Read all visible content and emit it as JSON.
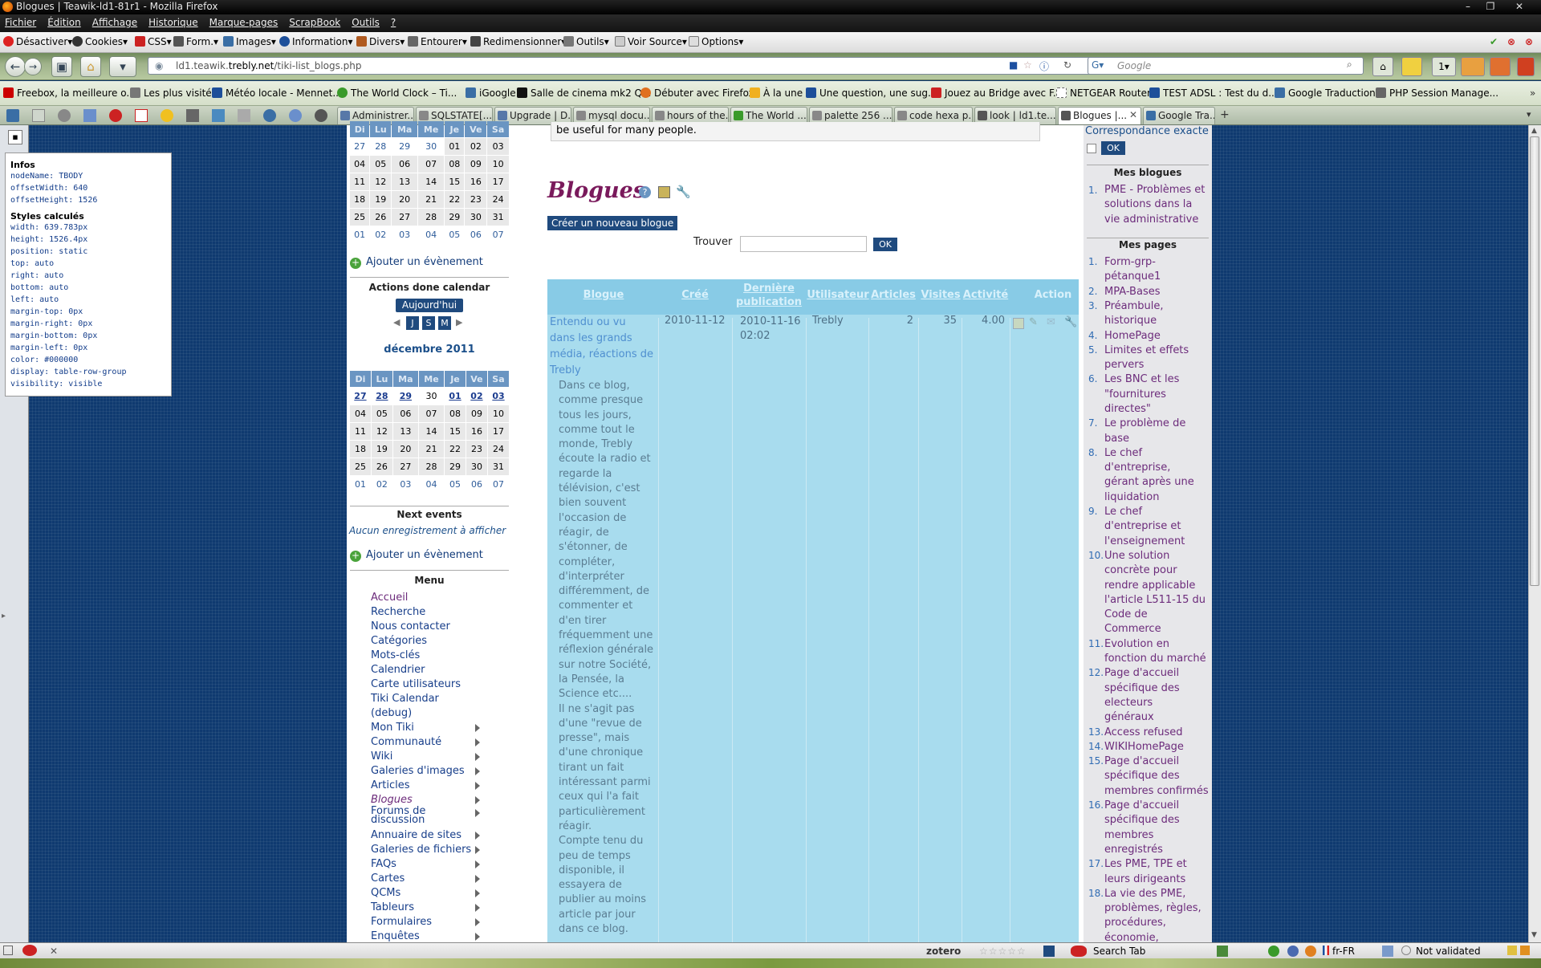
{
  "window": {
    "title": "Blogues | Teawik-ld1-81r1 - Mozilla Firefox"
  },
  "menubar": [
    "Fichier",
    "Édition",
    "Affichage",
    "Historique",
    "Marque-pages",
    "ScrapBook",
    "Outils",
    "?"
  ],
  "webdev": [
    "Désactiver",
    "Cookies",
    "CSS",
    "Form.",
    "Images",
    "Information",
    "Divers",
    "Entourer",
    "Redimensionner",
    "Outils",
    "Voir Source",
    "Options"
  ],
  "url": {
    "pre": "ld1.teawik.",
    "host": "trebly.net",
    "path": "/tiki-list_blogs.php"
  },
  "search": {
    "placeholder": "Google"
  },
  "bookmarks": [
    "Freebox, la meilleure o...",
    "Les plus visités",
    "Météo locale - Mennet...",
    "The World Clock – Ti...",
    "iGoogle",
    "Salle de cinema mk2 Q...",
    "Débuter avec Firefox",
    "À la une",
    "Une question, une sug...",
    "Jouez au Bridge avec F...",
    "NETGEAR Router",
    "TEST ADSL : Test du d...",
    "Google Traduction",
    "PHP Session Manage..."
  ],
  "tabs": [
    "Administrer...",
    "SQLSTATE[...",
    "Upgrade | D...",
    "mysql docu...",
    "hours of the...",
    "The World ...",
    "palette 256 ...",
    "code hexa p...",
    "look | ld1.te...",
    "Blogues |...",
    "Google Tra..."
  ],
  "inspector": {
    "infos_title": "Infos",
    "infos": [
      "nodeName: TBODY",
      "offsetWidth: 640",
      "offsetHeight: 1526"
    ],
    "styles_title": "Styles calculés",
    "styles": [
      "width: 639.783px",
      "height: 1526.4px",
      "position: static",
      "top: auto",
      "right: auto",
      "bottom: auto",
      "left: auto",
      "margin-top: 0px",
      "margin-right: 0px",
      "margin-bottom: 0px",
      "margin-left: 0px",
      "color: #000000",
      "display: table-row-group",
      "visibility: visible"
    ]
  },
  "calendar_top": {
    "days": [
      "Di",
      "Lu",
      "Ma",
      "Me",
      "Je",
      "Ve",
      "Sa"
    ],
    "rows": [
      [
        "27",
        "28",
        "29",
        "30",
        "01",
        "02",
        "03"
      ],
      [
        "04",
        "05",
        "06",
        "07",
        "08",
        "09",
        "10"
      ],
      [
        "11",
        "12",
        "13",
        "14",
        "15",
        "16",
        "17"
      ],
      [
        "18",
        "19",
        "20",
        "21",
        "22",
        "23",
        "24"
      ],
      [
        "25",
        "26",
        "27",
        "28",
        "29",
        "30",
        "31"
      ],
      [
        "01",
        "02",
        "03",
        "04",
        "05",
        "06",
        "07"
      ]
    ]
  },
  "add_event": "Ajouter un évènement",
  "actions_title": "Actions done calendar",
  "today_button": "Aujourd'hui",
  "view_buttons": [
    "J",
    "S",
    "M"
  ],
  "month_title": "décembre 2011",
  "calendar_bottom": {
    "days": [
      "Di",
      "Lu",
      "Ma",
      "Me",
      "Je",
      "Ve",
      "Sa"
    ],
    "rows": [
      [
        "27",
        "28",
        "29",
        "30",
        "01",
        "02",
        "03"
      ],
      [
        "04",
        "05",
        "06",
        "07",
        "08",
        "09",
        "10"
      ],
      [
        "11",
        "12",
        "13",
        "14",
        "15",
        "16",
        "17"
      ],
      [
        "18",
        "19",
        "20",
        "21",
        "22",
        "23",
        "24"
      ],
      [
        "25",
        "26",
        "27",
        "28",
        "29",
        "30",
        "31"
      ],
      [
        "01",
        "02",
        "03",
        "04",
        "05",
        "06",
        "07"
      ]
    ]
  },
  "next_events_title": "Next events",
  "no_records": "Aucun enregistrement à afficher",
  "menu_title": "Menu",
  "menu": [
    "Accueil",
    "Recherche",
    "Nous contacter",
    "Catégories",
    "Mots-clés",
    "Calendrier",
    "Carte utilisateurs",
    "Tiki Calendar",
    "(debug)",
    "Mon Tiki",
    "Communauté",
    "Wiki",
    "Galeries d'images",
    "Articles",
    "Blogues",
    "Forums de",
    "discussion",
    "Annuaire de sites",
    "Galeries de fichiers",
    "FAQs",
    "Cartes",
    "QCMs",
    "Tableurs",
    "Formulaires",
    "Enquêtes"
  ],
  "main": {
    "top_fragment": "be useful for many people.",
    "title": "Blogues",
    "create_button": "Créer un nouveau blogue",
    "find_label": "Trouver",
    "ok": "OK"
  },
  "table": {
    "headers": [
      "Blogue",
      "Créé",
      "Dernière",
      "publication",
      "Utilisateur",
      "Articles",
      "Visites",
      "Activité",
      "Action"
    ],
    "row": {
      "title": [
        "Entendu ou vu",
        "dans les grands",
        "média, réactions de",
        "Trebly"
      ],
      "created": "2010-11-12",
      "last_pub_date": "2010-11-16",
      "last_pub_time": "02:02",
      "user": "Trebly",
      "articles": "2",
      "visits": "35",
      "activity": "4.00",
      "description": [
        "Dans ce blog,",
        "comme presque",
        "tous les jours,",
        "comme tout le",
        "monde, Trebly",
        "écoute la radio et",
        "regarde la",
        "télévision, c'est",
        "bien souvent",
        "l'occasion de",
        "réagir, de",
        "s'étonner, de",
        "compléter,",
        "d'interpréter",
        "différemment, de",
        "commenter et",
        "d'en tirer",
        "fréquemment une",
        "réflexion générale",
        "sur notre Société,",
        "la Pensée, la",
        "Science etc....",
        "Il ne s'agit pas",
        "d'une \"revue de",
        "presse\", mais",
        "d'une chronique",
        "tirant un fait",
        "intéressant parmi",
        "ceux qui l'a fait",
        "particulièrement",
        "réagir.",
        "Compte tenu du",
        "peu de temps",
        "disponible, il",
        "essayera de",
        "publier au moins",
        "article par jour",
        "dans ce blog."
      ]
    }
  },
  "right": {
    "exact_match": "Correspondance exacte",
    "ok": "OK",
    "my_blogs_title": "Mes blogues",
    "my_blogs": [
      "PME - Problèmes et",
      "solutions dans la",
      "vie administrative"
    ],
    "my_pages_title": "Mes pages",
    "pages": [
      {
        "n": "1.",
        "lines": [
          "Form-grp-",
          "pétanque1"
        ]
      },
      {
        "n": "2.",
        "lines": [
          "MPA-Bases"
        ]
      },
      {
        "n": "3.",
        "lines": [
          "Préambule,",
          "historique"
        ]
      },
      {
        "n": "4.",
        "lines": [
          "HomePage"
        ]
      },
      {
        "n": "5.",
        "lines": [
          "Limites et effets",
          "pervers"
        ]
      },
      {
        "n": "6.",
        "lines": [
          "Les BNC et les",
          "\"fournitures",
          "directes\""
        ]
      },
      {
        "n": "7.",
        "lines": [
          "Le problème de",
          "base"
        ]
      },
      {
        "n": "8.",
        "lines": [
          "Le chef",
          "d'entreprise,",
          "gérant après une",
          "liquidation"
        ]
      },
      {
        "n": "9.",
        "lines": [
          "Le chef",
          "d'entreprise et",
          "l'enseignement"
        ]
      },
      {
        "n": "10.",
        "lines": [
          "Une solution",
          "concrète pour",
          "rendre applicable",
          "l'article L511-15 du",
          "Code de",
          "Commerce"
        ]
      },
      {
        "n": "11.",
        "lines": [
          "Evolution en",
          "fonction du marché"
        ]
      },
      {
        "n": "12.",
        "lines": [
          "Page d'accueil",
          "spécifique des",
          "electeurs",
          "généraux"
        ]
      },
      {
        "n": "13.",
        "lines": [
          "Access refused"
        ]
      },
      {
        "n": "14.",
        "lines": [
          "WIKIHomePage"
        ]
      },
      {
        "n": "15.",
        "lines": [
          "Page d'accueil",
          "spécifique des",
          "membres confirmés"
        ]
      },
      {
        "n": "16.",
        "lines": [
          "Page d'accueil",
          "spécifique des",
          "membres",
          "enregistrés"
        ]
      },
      {
        "n": "17.",
        "lines": [
          "Les PME, TPE et",
          "leurs dirigeants"
        ]
      },
      {
        "n": "18.",
        "lines": [
          "La vie des PME,",
          "problèmes, règles,",
          "procédures,",
          "économie,"
        ]
      }
    ]
  },
  "status": {
    "zotero": "zotero",
    "search_tab": "Search Tab",
    "lang": "fr-FR",
    "validation": "Not validated"
  },
  "colors": {
    "page_bg": "#0f3a70",
    "table_bg": "#a8dcee",
    "title": "#7a1a5c",
    "link": "#173e8a"
  }
}
